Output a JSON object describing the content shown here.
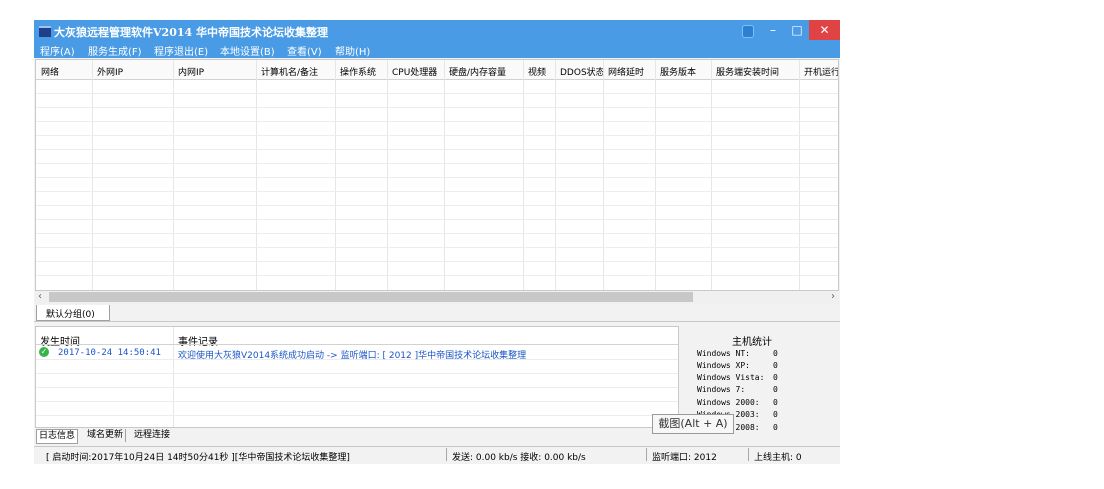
{
  "window": {
    "title": "大灰狼远程管理软件V2014  华中帝国技术论坛收集整理",
    "minimize": "–",
    "maximize": "□",
    "close": "✕"
  },
  "menu": [
    "程序(A)",
    "服务生成(F)",
    "程序退出(E)",
    "本地设置(B)",
    "查看(V)",
    "帮助(H)"
  ],
  "grid": {
    "columns": [
      "网络",
      "外网IP",
      "内网IP",
      "计算机名/备注",
      "操作系统",
      "CPU处理器",
      "硬盘/内存容量",
      "视频",
      "DDOS状态",
      "网络延时",
      "服务版本",
      "服务端安装时间",
      "开机运行"
    ]
  },
  "scrollbar": {
    "left": "‹",
    "right": "›"
  },
  "group_tab": "默认分组(0)",
  "log": {
    "headers": {
      "time": "发生时间",
      "event": "事件记录"
    },
    "entries": [
      {
        "time": "2017-10-24 14:50:41",
        "event": "欢迎使用大灰狼V2014系统成功启动 -> 监听端口: [ 2012 ]华中帝国技术论坛收集整理",
        "status": "ok"
      }
    ]
  },
  "stats": {
    "title": "主机统计",
    "rows": [
      {
        "label": "Windows NT:",
        "value": "0"
      },
      {
        "label": "Windows XP:",
        "value": "0"
      },
      {
        "label": "Windows Vista:",
        "value": "0"
      },
      {
        "label": "Windows 7:",
        "value": "0"
      },
      {
        "label": "Windows 2000:",
        "value": "0"
      },
      {
        "label": "Windows 2003:",
        "value": "0"
      },
      {
        "label": "Windows 2008:",
        "value": "0"
      }
    ]
  },
  "tooltip": "截图(Alt + A)",
  "bottom_tabs": [
    "日志信息",
    "域名更新",
    "远程连接"
  ],
  "statusbar": {
    "start": "[ 启动时间:2017年10月24日 14时50分41秒 ][华中帝国技术论坛收集整理]",
    "traffic": "发送: 0.00 kb/s 接收: 0.00 kb/s",
    "port": "监听端口: 2012",
    "online": "上线主机: 0"
  },
  "colors": {
    "titlebar": "#4a9be5",
    "close": "#e04343",
    "log_text": "#1a55c8",
    "ok": "#36b44a"
  }
}
